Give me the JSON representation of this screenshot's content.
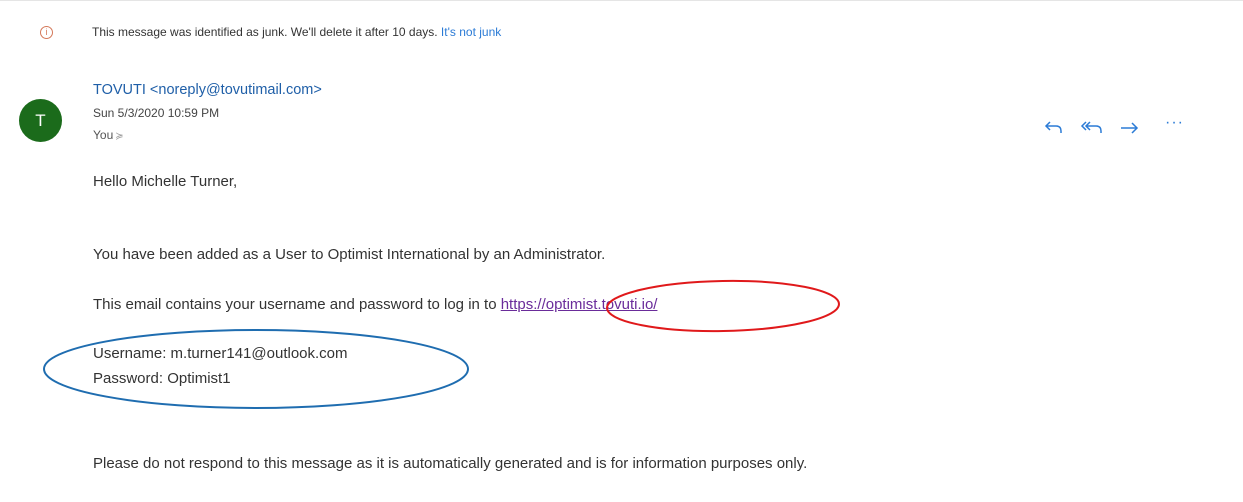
{
  "junk_banner": {
    "icon": "info-icon",
    "message": "This message was identified as junk. We'll delete it after 10 days.",
    "action_label": "It's not junk"
  },
  "email": {
    "avatar_letter": "T",
    "sender": "TOVUTI <noreply@tovutimail.com>",
    "date": "Sun 5/3/2020 10:59 PM",
    "recipient": "You",
    "recipient_chevron": "≽",
    "actions": [
      {
        "name": "reply",
        "icon": "reply-icon"
      },
      {
        "name": "reply-all",
        "icon": "reply-all-icon"
      },
      {
        "name": "forward",
        "icon": "forward-icon"
      },
      {
        "name": "more",
        "icon": "more-icon",
        "label": "···"
      }
    ],
    "body": {
      "greeting": "Hello Michelle Turner,",
      "line_added": "You have been added as a User to Optimist International by an Administrator.",
      "line_credentials_prefix": "This email contains your username and password to log in to ",
      "login_url": "https://optimist.tovuti.io/",
      "username_line": "Username: m.turner141@outlook.com",
      "password_line": "Password: Optimist1",
      "footer_line": "Please do not respond to this message as it is automatically generated and is for information purposes only."
    }
  },
  "annotations": {
    "url_ellipse_color": "#e0191b",
    "credentials_ellipse_color": "#1f6db0"
  }
}
